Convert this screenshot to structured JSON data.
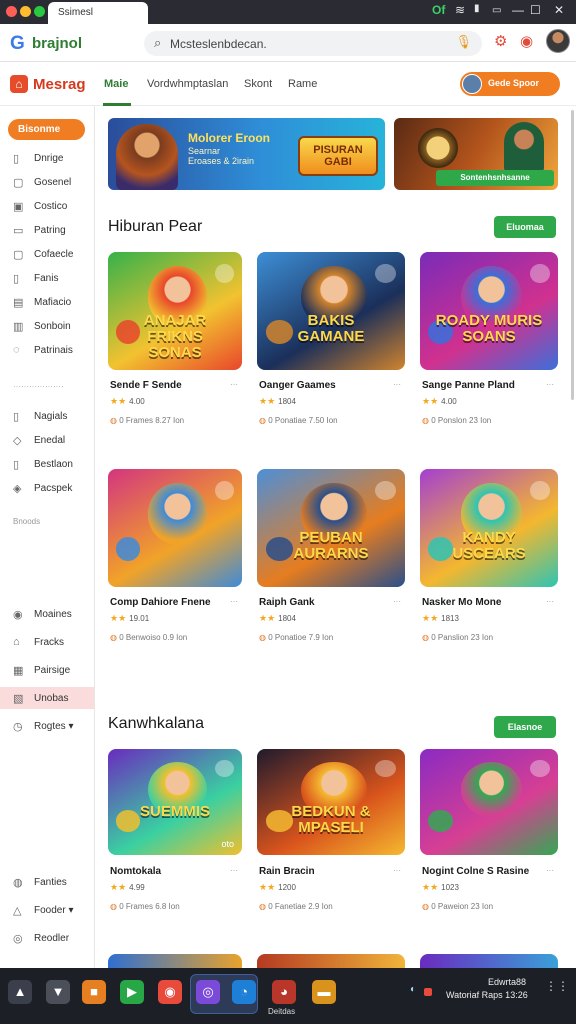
{
  "window": {
    "tab_title": "Ssimesl",
    "tray_left": "Of",
    "min_glyph": "—",
    "max_glyph": "☐",
    "close_glyph": "✕"
  },
  "toolbar": {
    "logo_letter": "G",
    "logo_text": "brajnol",
    "search_value": "Mcsteslenbdecan.",
    "search_icon": "search-icon",
    "mic_icon": "mic-icon"
  },
  "site": {
    "brand": "Mesrag",
    "nav": [
      "Maie",
      "Vordwhmptaslan",
      "Skont",
      "Rame"
    ],
    "header_button": "Gede Spoor"
  },
  "sidebar": {
    "primary": "Bisonme",
    "items_top": [
      {
        "icon": "▯",
        "label": "Dnrige"
      },
      {
        "icon": "▢",
        "label": "Gosenel"
      },
      {
        "icon": "▣",
        "label": "Costico"
      },
      {
        "icon": "▭",
        "label": "Patring"
      },
      {
        "icon": "▢",
        "label": "Cofaecle"
      },
      {
        "icon": "▯",
        "label": "Fanis"
      },
      {
        "icon": "▤",
        "label": "Mafiacio"
      },
      {
        "icon": "▥",
        "label": "Sonboin"
      },
      {
        "icon": "◌",
        "label": "Patrinais"
      }
    ],
    "separator1": "···················",
    "items_mid": [
      {
        "icon": "▯",
        "label": "Nagials"
      },
      {
        "icon": "◇",
        "label": "Enedal"
      },
      {
        "icon": "▯",
        "label": "Bestlaon"
      },
      {
        "icon": "◈",
        "label": "Pacspek"
      }
    ],
    "note": "Bnoods",
    "items_low": [
      {
        "icon": "◉",
        "label": "Moaines"
      },
      {
        "icon": "⌂",
        "label": "Fracks"
      },
      {
        "icon": "▦",
        "label": "Pairsige"
      },
      {
        "icon": "▧",
        "label": "Unobas"
      },
      {
        "icon": "◷",
        "label": "Rogtes ▾"
      }
    ],
    "items_bottom": [
      {
        "icon": "◍",
        "label": "Fanties"
      },
      {
        "icon": "△",
        "label": "Fooder ▾"
      },
      {
        "icon": "◎",
        "label": "Reodler"
      }
    ]
  },
  "banners": {
    "b1_title": "Molorer Eroon",
    "b1_sub": "Searnar\nEroases & 2irain",
    "b1_badge": "PISURAN\nGABI",
    "b2_cta": "Sontenhsnhsanne"
  },
  "section1": {
    "title": "Hiburan Pear",
    "button": "Eluomaa",
    "cards": [
      {
        "art": "ANAJAR\nFRIKNS\nSONAS",
        "name": "Sende F Sende",
        "more": "···",
        "rating": "4.00",
        "meta": "0 Frames  8.27 Ion",
        "colors": [
          "#35b24a",
          "#f2c230",
          "#e8462b"
        ]
      },
      {
        "art": "BAKIS\nGAMANE",
        "name": "Oanger Gaames",
        "more": "···",
        "rating": "1804",
        "meta": "0 Ponatiae  7.50 Ion",
        "colors": [
          "#3d8fd6",
          "#1b2f5a",
          "#d1842d"
        ]
      },
      {
        "art": "ROADY MURIS\nSOANS",
        "name": "Sange Panne Pland",
        "more": "···",
        "rating": "4.00",
        "meta": "0 Ponslon  23 Ion",
        "colors": [
          "#7a2bb8",
          "#d0318f",
          "#3b6fd9"
        ]
      },
      {
        "art": "",
        "name": "Comp Dahiore Fnene",
        "more": "···",
        "rating": "19.01",
        "meta": "0 Benwoiso  0.9 Ion",
        "colors": [
          "#d3357f",
          "#f1a328",
          "#3e8bd8"
        ]
      },
      {
        "art": "PEUBAN\nAURARNS",
        "name": "Raiph Gank",
        "more": "···",
        "rating": "1804",
        "meta": "0 Ponatioe  7.9 Ion",
        "colors": [
          "#4d8fd8",
          "#e67d1f",
          "#2a4f8a"
        ]
      },
      {
        "art": "KANDY\nUSCEARS",
        "name": "Nasker Mo Mone",
        "more": "···",
        "rating": "1813",
        "meta": "0 Panslion  23 Ion",
        "colors": [
          "#a43fd1",
          "#f4b72f",
          "#2ec4b3"
        ]
      }
    ]
  },
  "section2": {
    "title": "Kanwhkalana",
    "button": "Elasnoe",
    "cards": [
      {
        "art": "SUEMMIS",
        "corner": "oto",
        "name": "Nomtokala",
        "more": "···",
        "rating": "4.99",
        "meta": "0 Frames  6.8 Ion",
        "colors": [
          "#6a2bbf",
          "#3ad0a1",
          "#f0c02e"
        ]
      },
      {
        "art": "BEDKUN &\nMPASELI",
        "corner": "",
        "name": "Rain Bracin",
        "more": "···",
        "rating": "1200",
        "meta": "0 Fanetiae  2.9 Ion",
        "colors": [
          "#1f1a2e",
          "#d9541c",
          "#f5b830"
        ]
      },
      {
        "art": "",
        "corner": "",
        "name": "Nogint Colne S Rasine",
        "more": "···",
        "rating": "1023",
        "meta": "0 Paweion  23 Ion",
        "colors": [
          "#8a2bc2",
          "#d73f93",
          "#34a853"
        ]
      }
    ]
  },
  "taskbar": {
    "apps": [
      {
        "icon": "files-icon",
        "glyph": "▲",
        "bg": "#3a3f4b"
      },
      {
        "icon": "terminal-icon",
        "glyph": "▼",
        "bg": "#4a4f5a"
      },
      {
        "icon": "store-icon",
        "glyph": "■",
        "bg": "#e67e22"
      },
      {
        "icon": "sheets-icon",
        "glyph": "▶",
        "bg": "#27a745"
      },
      {
        "icon": "photos-icon",
        "glyph": "◉",
        "bg": "#e84a3b"
      },
      {
        "icon": "browser-icon",
        "glyph": "◎",
        "bg": "#7b4ad9"
      },
      {
        "icon": "edge-icon",
        "glyph": "◔",
        "bg": "#1d7fd6"
      },
      {
        "icon": "music-icon",
        "glyph": "◕",
        "bg": "#b8362a"
      },
      {
        "icon": "folder-icon",
        "glyph": "▬",
        "bg": "#d9931d"
      }
    ],
    "active_label": "Deitdas",
    "clock_line1": "Edwrta88",
    "clock_line2": "Watoriaf Raps  13:26"
  }
}
